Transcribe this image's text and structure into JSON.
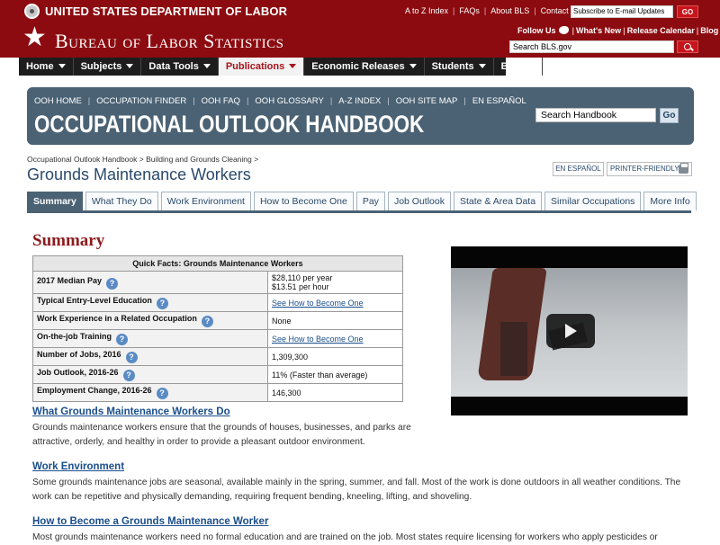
{
  "header": {
    "dol_title": "UNITED STATES DEPARTMENT OF LABOR",
    "top_links": [
      "A to Z Index",
      "FAQs",
      "About BLS",
      "Contact Us"
    ],
    "email_updates_placeholder": "Subscribe to E-mail Updates",
    "go_label": "GO",
    "bls_title": "Bureau of Labor Statistics",
    "follow_us": "Follow Us",
    "right_links": [
      "What's New",
      "Release Calendar",
      "Blog"
    ],
    "search_placeholder": "Search BLS.gov"
  },
  "nav": {
    "items": [
      {
        "label": "Home"
      },
      {
        "label": "Subjects"
      },
      {
        "label": "Data Tools"
      },
      {
        "label": "Publications"
      },
      {
        "label": "Economic Releases"
      },
      {
        "label": "Students"
      },
      {
        "label": "Beta"
      }
    ],
    "active": "Publications"
  },
  "ooh": {
    "links": [
      "OOH HOME",
      "OCCUPATION FINDER",
      "OOH FAQ",
      "OOH GLOSSARY",
      "A-Z INDEX",
      "OOH SITE MAP",
      "EN ESPAÑOL"
    ],
    "title": "OCCUPATIONAL OUTLOOK HANDBOOK",
    "search_placeholder": "Search Handbook",
    "go_label": "Go"
  },
  "breadcrumb": {
    "items": [
      "Occupational Outlook Handbook",
      "Building and Grounds Cleaning"
    ]
  },
  "page": {
    "title": "Grounds Maintenance Workers",
    "en_espanol": "EN ESPAÑOL",
    "printer_friendly": "PRINTER-FRIENDLY"
  },
  "tabs": [
    {
      "label": "Summary"
    },
    {
      "label": "What They Do"
    },
    {
      "label": "Work Environment"
    },
    {
      "label": "How to Become One"
    },
    {
      "label": "Pay"
    },
    {
      "label": "Job Outlook"
    },
    {
      "label": "State & Area Data"
    },
    {
      "label": "Similar Occupations"
    },
    {
      "label": "More Info"
    }
  ],
  "summary": {
    "heading": "Summary",
    "table_title": "Quick Facts: Grounds Maintenance Workers",
    "rows": [
      {
        "label": "2017 Median Pay",
        "value": "$28,110 per year",
        "value2": "$13.51 per hour"
      },
      {
        "label": "Typical Entry-Level Education",
        "value": "See How to Become One"
      },
      {
        "label": "Work Experience in a Related Occupation",
        "value": "None"
      },
      {
        "label": "On-the-job Training",
        "value": "See How to Become One"
      },
      {
        "label": "Number of Jobs, 2016",
        "value": "1,309,300"
      },
      {
        "label": "Job Outlook, 2016-26",
        "value": "11% (Faster than average)"
      },
      {
        "label": "Employment Change, 2016-26",
        "value": "146,300"
      }
    ]
  },
  "sections": [
    {
      "heading": "What Grounds Maintenance Workers Do",
      "text": "Grounds maintenance workers ensure that the grounds of houses, businesses, and parks are attractive, orderly, and healthy in order to provide a pleasant outdoor environment."
    },
    {
      "heading": "Work Environment",
      "text": "Some grounds maintenance jobs are seasonal, available mainly in the spring, summer, and fall. Most of the work is done outdoors in all weather conditions. The work can be repetitive and physically demanding, requiring frequent bending, kneeling, lifting, and shoveling."
    },
    {
      "heading": "How to Become a Grounds Maintenance Worker",
      "text": "Most grounds maintenance workers need no formal education and are trained on the job. Most states require licensing for workers who apply pesticides or"
    }
  ]
}
